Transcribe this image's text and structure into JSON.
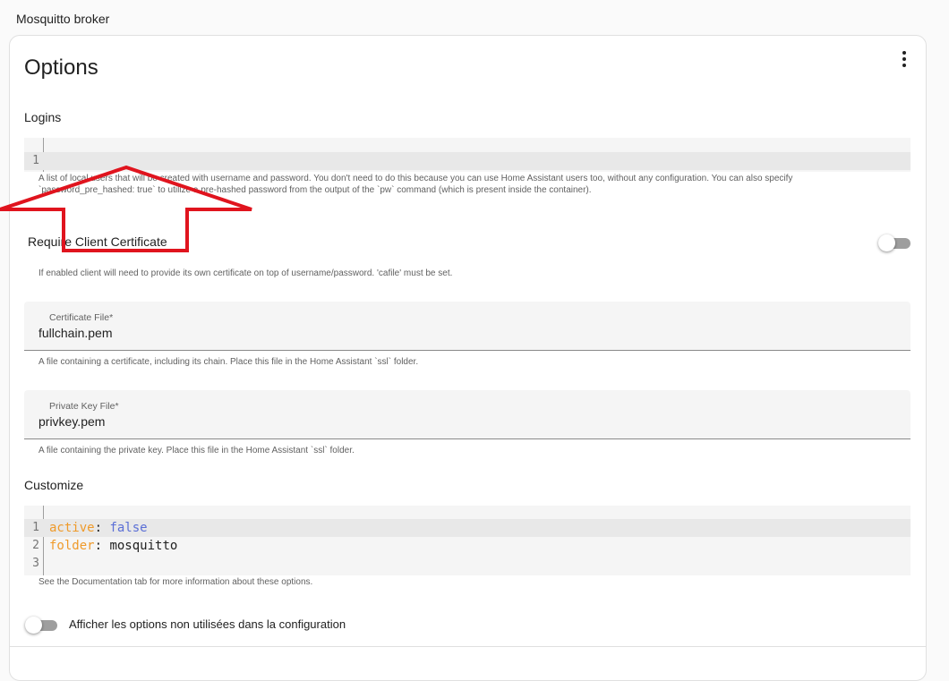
{
  "app": {
    "title": "Mosquitto broker"
  },
  "card": {
    "title": "Options"
  },
  "logins": {
    "label": "Logins",
    "line_numbers": [
      "1"
    ],
    "helper_line1": "A list of local users that will be created with username and password. You don't need to do this because you can use Home Assistant users too, without any configuration. You can also specify",
    "helper_line2": "`password_pre_hashed: true` to utilize a pre-hashed password from the output of the `pw` command (which is present inside the container)."
  },
  "require_cert": {
    "label": "Require Client Certificate",
    "enabled": false,
    "helper": "If enabled client will need to provide its own certificate on top of username/password. 'cafile' must be set."
  },
  "certfile": {
    "label": "Certificate File*",
    "value": "fullchain.pem",
    "helper": "A file containing a certificate, including its chain. Place this file in the Home Assistant `ssl` folder."
  },
  "keyfile": {
    "label": "Private Key File*",
    "value": "privkey.pem",
    "helper": "A file containing the private key. Place this file in the Home Assistant `ssl` folder."
  },
  "customize": {
    "label": "Customize",
    "lines": [
      {
        "num": "1",
        "key": "active",
        "sep": ": ",
        "value": "false"
      },
      {
        "num": "2",
        "key": "folder",
        "sep": ": ",
        "value": "mosquitto"
      },
      {
        "num": "3",
        "key": "",
        "sep": "",
        "value": ""
      }
    ],
    "helper": "See the Documentation tab for more information about these options."
  },
  "show_unused": {
    "label": "Afficher les options non utilisées dans la configuration",
    "enabled": false
  },
  "colors": {
    "annotation_arrow": "#e0141e",
    "yaml_key": "#ef9a2a",
    "yaml_bool": "#5b6fd6"
  },
  "icons": {
    "menu": "kebab-menu-icon",
    "annotation": "red-arrow-annotation"
  }
}
